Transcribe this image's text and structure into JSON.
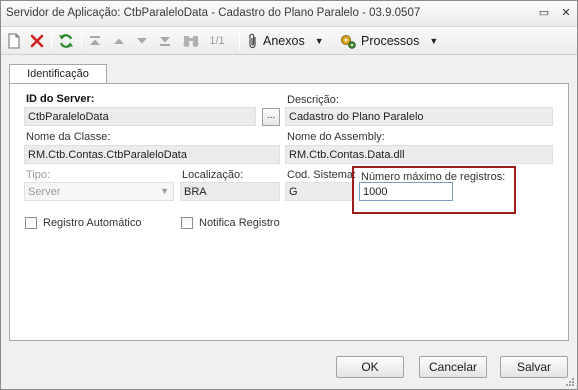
{
  "window": {
    "title": "Servidor de Aplicação: CtbParaleloData - Cadastro do Plano Paralelo - 03.9.0507",
    "minimize_glyph": "▭",
    "close_glyph": "✕"
  },
  "toolbar": {
    "items": [
      "new-icon",
      "delete-icon",
      "refresh-icon",
      "first-icon",
      "previous-icon",
      "next-icon",
      "last-icon",
      "binoculars-icon"
    ],
    "page_indicator": "1/1",
    "anexos_label": "Anexos",
    "processos_label": "Processos",
    "dropdown_caret": "▼"
  },
  "tabs": [
    "Identificação"
  ],
  "form": {
    "id_server": {
      "label": "ID do Server:",
      "value": "CtbParaleloData",
      "browse_label": "..."
    },
    "descricao": {
      "label": "Descrição:",
      "value": "Cadastro do Plano Paralelo"
    },
    "nome_classe": {
      "label": "Nome da Classe:",
      "value": "RM.Ctb.Contas.CtbParaleloData"
    },
    "nome_assembly": {
      "label": "Nome do Assembly:",
      "value": "RM.Ctb.Contas.Data.dll"
    },
    "tipo": {
      "label": "Tipo:",
      "value": "Server",
      "arrow": "▼"
    },
    "localizacao": {
      "label": "Localização:",
      "value": "BRA"
    },
    "cod_sistema": {
      "label": "Cod. Sistema:",
      "value": "G"
    },
    "max_registros": {
      "label": "Número máximo de registros:",
      "value": "1000"
    },
    "registro_automatico": {
      "label": "Registro Automático",
      "checked": false
    },
    "notifica_registro": {
      "label": "Notifica Registro",
      "checked": false
    }
  },
  "buttons": {
    "ok": "OK",
    "cancelar": "Cancelar",
    "salvar": "Salvar"
  },
  "colors": {
    "highlight": "#9e1d1d",
    "field_bg": "#ececec",
    "panel_bg": "#ffffff",
    "window_bg": "#f0f0f0"
  }
}
